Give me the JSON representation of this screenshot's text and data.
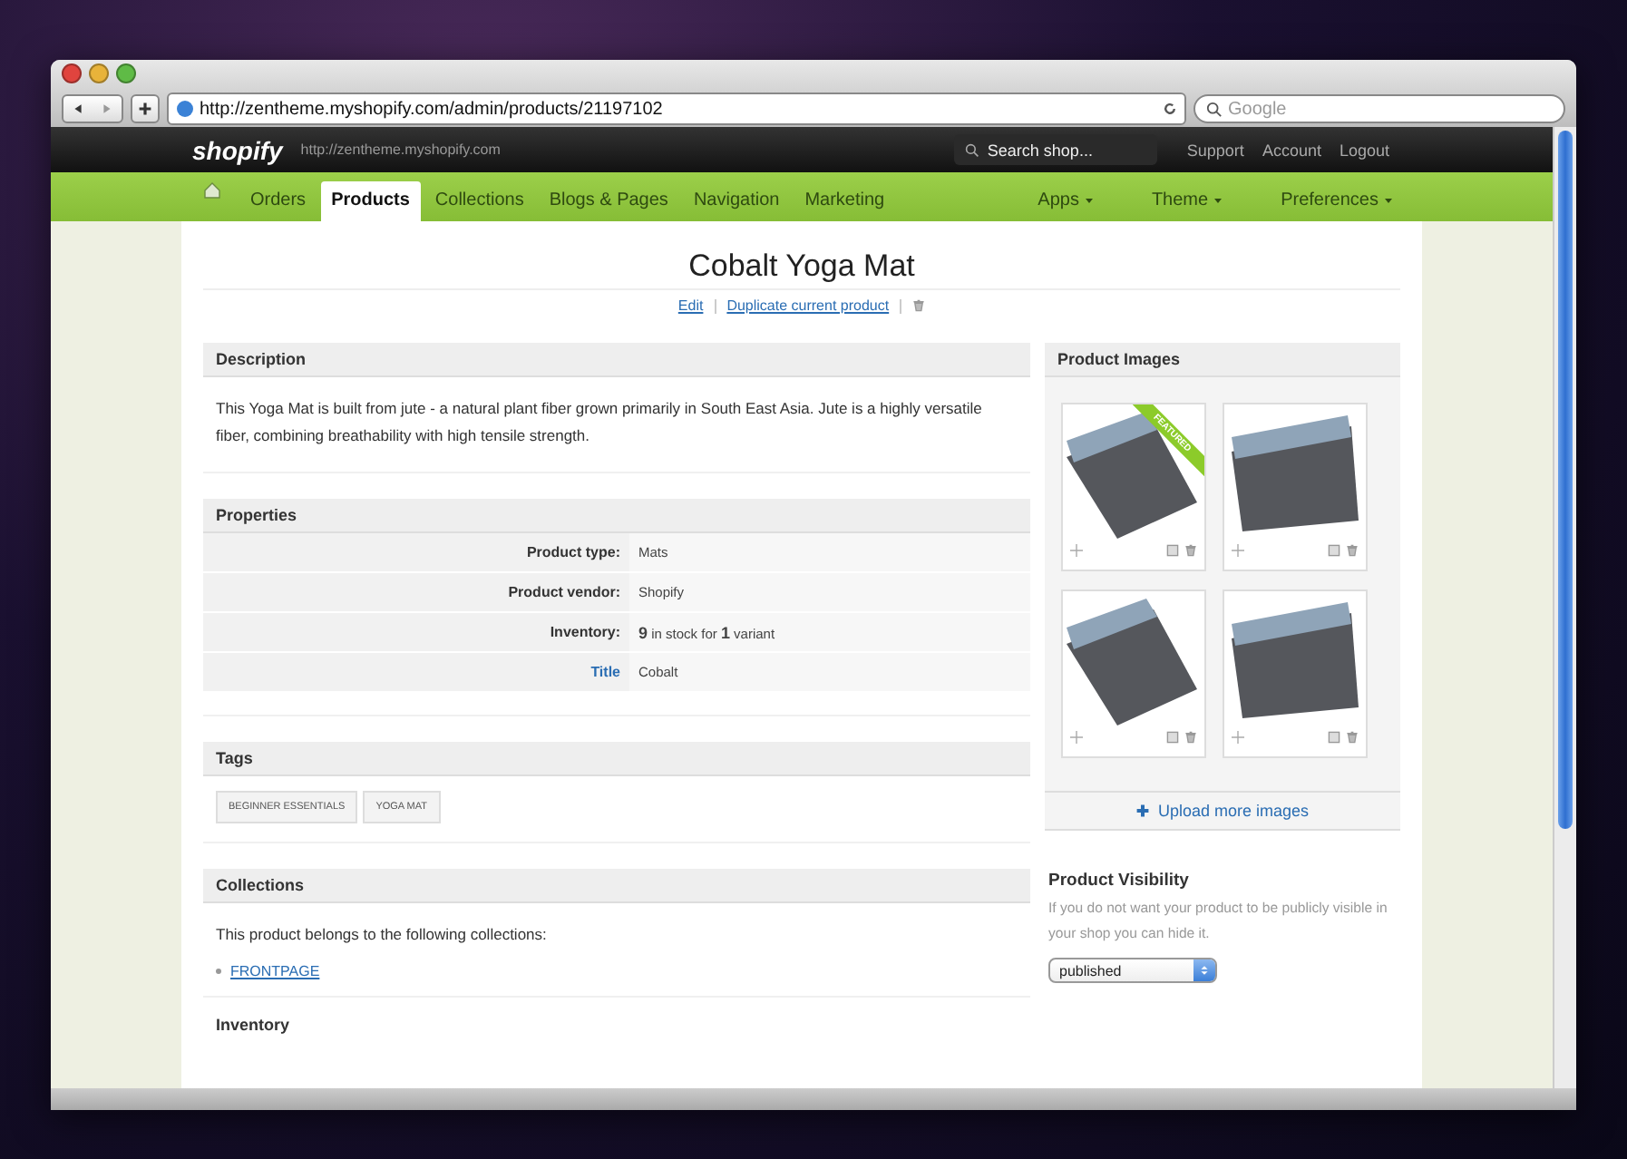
{
  "browser": {
    "url": "http://zentheme.myshopify.com/admin/products/21197102",
    "search_placeholder": "Google"
  },
  "topbar": {
    "logo": "shopify",
    "store_url": "http://zentheme.myshopify.com",
    "search_placeholder": "Search shop...",
    "links": [
      "Support",
      "Account",
      "Logout"
    ]
  },
  "nav": {
    "items": [
      {
        "label": "Orders",
        "selected": false
      },
      {
        "label": "Products",
        "selected": true
      },
      {
        "label": "Collections",
        "selected": false
      },
      {
        "label": "Blogs & Pages",
        "selected": false
      },
      {
        "label": "Navigation",
        "selected": false
      },
      {
        "label": "Marketing",
        "selected": false
      }
    ],
    "menus": [
      "Apps",
      "Theme",
      "Preferences"
    ]
  },
  "product": {
    "title": "Cobalt Yoga Mat",
    "actions": [
      "Edit",
      "Duplicate current product"
    ]
  },
  "description": {
    "heading": "Description",
    "text": "This Yoga Mat is built from jute - a natural plant fiber grown primarily in South East Asia. Jute is a highly versatile fiber, combining breathability with high tensile strength."
  },
  "properties": {
    "heading": "Properties",
    "rows": [
      {
        "kind": "plain",
        "label": "Product type:",
        "value": "Mats"
      },
      {
        "kind": "plain",
        "label": "Product vendor:",
        "value": "Shopify"
      },
      {
        "kind": "plain",
        "label": "Inventory:",
        "value": "**9** in stock for **1** variant"
      },
      {
        "kind": "link",
        "label": "Title",
        "value": "Cobalt"
      }
    ]
  },
  "tags": {
    "heading": "Tags",
    "items": [
      "BEGINNER ESSENTIALS",
      "YOGA MAT"
    ]
  },
  "collections": {
    "heading": "Collections",
    "text": "This product belongs to the following collections:",
    "items": [
      "FRONTPAGE"
    ]
  },
  "inventory": {
    "heading": "Inventory"
  },
  "images": {
    "heading": "Product Images",
    "featured_label": "FEATURED",
    "items": [
      {
        "featured": true
      },
      {
        "featured": false
      },
      {
        "featured": false
      },
      {
        "featured": false
      }
    ],
    "upload": "Upload more images"
  },
  "visibility": {
    "heading": "Product Visibility",
    "text": "If you do not want your product to be publicly visible in your shop you can hide it.",
    "select": "published"
  }
}
